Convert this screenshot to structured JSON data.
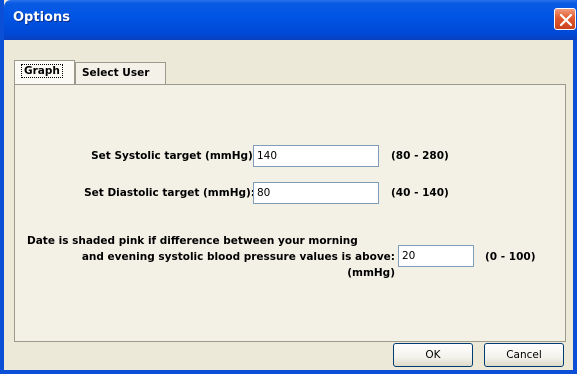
{
  "window": {
    "title": "Options"
  },
  "tabs": [
    {
      "label": "Graph",
      "active": true
    },
    {
      "label": "Select User",
      "active": false
    }
  ],
  "fields": {
    "systolic": {
      "label": "Set Systolic target (mmHg):",
      "value": "140",
      "range": "(80 - 280)"
    },
    "diastolic": {
      "label": "Set Diastolic target (mmHg):",
      "value": "80",
      "range": "(40 - 140)"
    },
    "difference": {
      "label_line1": "Date is shaded pink if difference between your morning",
      "label_line2": "and evening systolic blood pressure values is above:",
      "label_line3": "(mmHg)",
      "value": "20",
      "range": "(0 - 100)"
    }
  },
  "buttons": {
    "ok": "OK",
    "cancel": "Cancel"
  },
  "colors": {
    "titlebar": "#0055e5",
    "window_bg": "#ece9d8",
    "close": "#e2592f"
  },
  "icons": {
    "close": "close-icon"
  }
}
